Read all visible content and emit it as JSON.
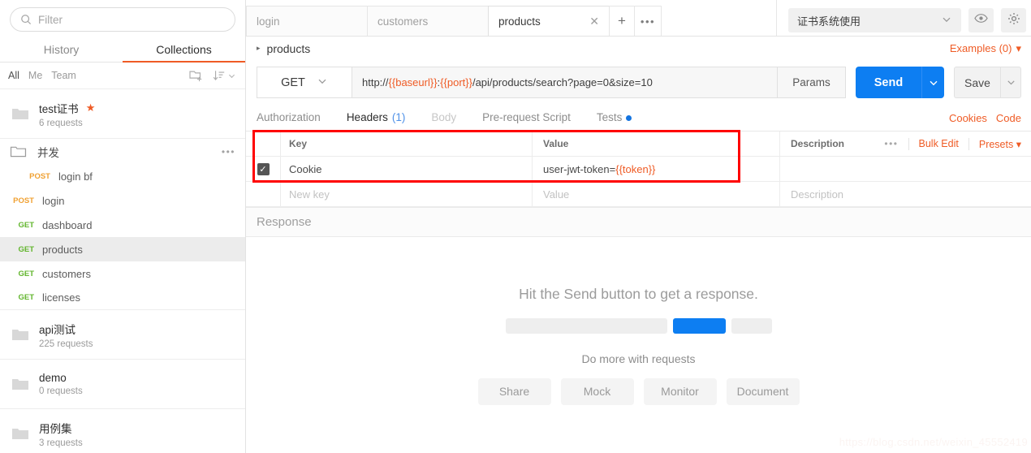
{
  "sidebar": {
    "search": {
      "placeholder": "Filter",
      "icon": "search-icon"
    },
    "tabs": [
      {
        "label": "History",
        "active": false
      },
      {
        "label": "Collections",
        "active": true
      }
    ],
    "scopes": [
      {
        "label": "All",
        "active": true
      },
      {
        "label": "Me",
        "active": false
      },
      {
        "label": "Team",
        "active": false
      }
    ],
    "actions": [
      {
        "name": "new-folder-icon"
      },
      {
        "name": "sort-icon"
      }
    ],
    "collections": [
      {
        "name": "test证书",
        "requests": "6 requests",
        "starred": true
      },
      {
        "name": "api测试",
        "requests": "225 requests",
        "starred": false
      },
      {
        "name": "demo",
        "requests": "0 requests",
        "starred": false
      },
      {
        "name": "用例集",
        "requests": "3 requests",
        "starred": false
      }
    ],
    "expanded": {
      "folder": "并发",
      "requests": [
        {
          "method": "POST",
          "name": "login bf",
          "indent": true,
          "selected": false
        },
        {
          "method": "POST",
          "name": "login",
          "indent": false,
          "selected": false
        },
        {
          "method": "GET",
          "name": "dashboard",
          "indent": false,
          "selected": false
        },
        {
          "method": "GET",
          "name": "products",
          "indent": false,
          "selected": true
        },
        {
          "method": "GET",
          "name": "customers",
          "indent": false,
          "selected": false
        },
        {
          "method": "GET",
          "name": "licenses",
          "indent": false,
          "selected": false
        }
      ]
    }
  },
  "topbar": {
    "request_tabs": [
      {
        "label": "login",
        "active": false
      },
      {
        "label": "customers",
        "active": false
      },
      {
        "label": "products",
        "active": true
      }
    ],
    "new_tab_label": "+",
    "tab_options_label": "•••",
    "environment": {
      "value": "证书系统使用",
      "chevron": "chevron-down-icon"
    },
    "eye_icon": "eye-icon",
    "settings_icon": "gear-icon"
  },
  "breadcrumb": {
    "arrow": "▸",
    "name": "products",
    "examples_label": "Examples (0)"
  },
  "request": {
    "method": "GET",
    "url_parts": [
      {
        "text": "http://",
        "variable": false
      },
      {
        "text": "{{baseurl}}",
        "variable": true
      },
      {
        "text": ":",
        "variable": false
      },
      {
        "text": "{{port}}",
        "variable": true
      },
      {
        "text": "/api/products/search?page=0&size=10",
        "variable": false
      }
    ],
    "url_full": "http://{{baseurl}}:{{port}}/api/products/search?page=0&size=10",
    "params_label": "Params",
    "send_label": "Send",
    "save_label": "Save"
  },
  "request_tabs": {
    "items": [
      {
        "label": "Authorization",
        "active": false,
        "dim": false,
        "count": null,
        "dot": false
      },
      {
        "label": "Headers",
        "active": true,
        "dim": false,
        "count": "(1)",
        "dot": false
      },
      {
        "label": "Body",
        "active": false,
        "dim": true,
        "count": null,
        "dot": false
      },
      {
        "label": "Pre-request Script",
        "active": false,
        "dim": false,
        "count": null,
        "dot": false
      },
      {
        "label": "Tests",
        "active": false,
        "dim": false,
        "count": null,
        "dot": true
      }
    ],
    "right_links": [
      {
        "label": "Cookies"
      },
      {
        "label": "Code"
      }
    ]
  },
  "headers_table": {
    "columns": [
      "Key",
      "Value",
      "Description"
    ],
    "tools": {
      "dots": "•••",
      "bulk_edit": "Bulk Edit",
      "presets": "Presets"
    },
    "rows": [
      {
        "checked": true,
        "key": "Cookie",
        "value_prefix": "user-jwt-token=",
        "value_variable": "{{token}}",
        "description": ""
      }
    ],
    "new_row": {
      "key_placeholder": "New key",
      "value_placeholder": "Value",
      "description_placeholder": "Description"
    }
  },
  "response": {
    "title": "Response",
    "empty_message": "Hit the Send button to get a response.",
    "secondary_message": "Do more with requests",
    "buttons": [
      "Share",
      "Mock",
      "Monitor",
      "Document"
    ]
  },
  "watermark": "https://blog.csdn.net/weixin_45552419",
  "colors": {
    "accent_orange": "#ef5b25",
    "send_blue": "#0d7ef2",
    "get_green": "#61b52c",
    "post_orange": "#f0a132",
    "highlight_red": "#ff0000"
  }
}
